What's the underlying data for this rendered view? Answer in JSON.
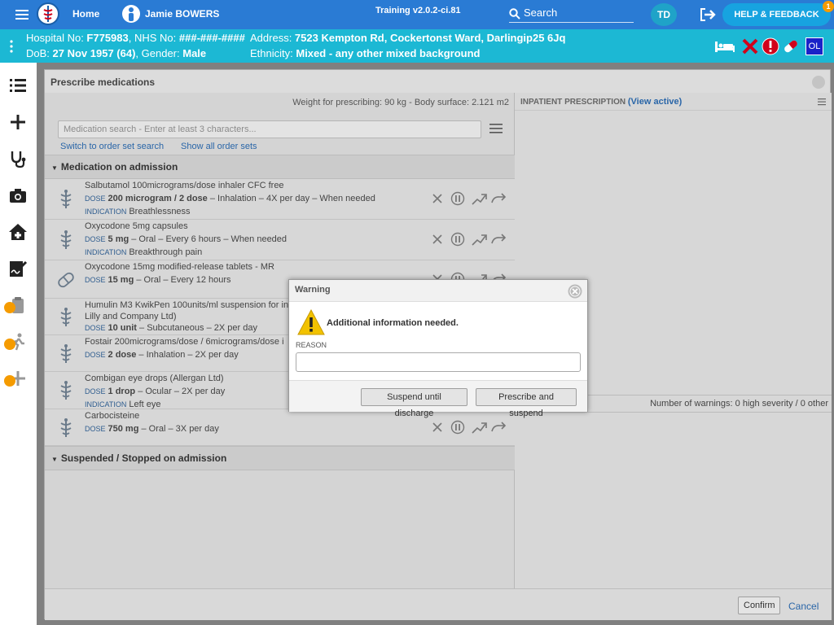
{
  "topbar": {
    "home": "Home",
    "patient_name": "Jamie BOWERS",
    "training": "Training v2.0.2-ci.81",
    "search": "Search",
    "user_initials": "TD",
    "help": "HELP & FEEDBACK",
    "help_badge": "1"
  },
  "banner": {
    "hospital_label": "Hospital No: ",
    "hospital_no": "F775983",
    "nhs_label": ", NHS No: ",
    "nhs_no": "###-###-####",
    "dob_label": "DoB: ",
    "dob": "27 Nov 1957 (64)",
    "gender_label": ", Gender: ",
    "gender": "Male",
    "address_label": "Address: ",
    "address": "7523 Kempton Rd, Cockertonst Ward, Darlingip25 6Jq",
    "ethnicity_label": "Ethnicity: ",
    "ethnicity": "Mixed - any other mixed background",
    "badge_ol": "OL"
  },
  "dialog": {
    "title": "Prescribe medications",
    "weight": "Weight for prescribing: 90 kg - Body surface: 2.121 m2",
    "search_placeholder": "Medication search - Enter at least 3 characters...",
    "switch_link": "Switch to order set search",
    "show_all_link": "Show all order sets",
    "section_admission": "Medication on admission",
    "section_suspended": "Suspended / Stopped on admission",
    "inpatient_title": "INPATIENT PRESCRIPTION",
    "view_active": "(View active)",
    "warnings_count": "Number of warnings: 0 high severity / 0 other",
    "confirm": "Confirm",
    "cancel": "Cancel"
  },
  "meds": [
    {
      "name": "Salbutamol 100micrograms/dose inhaler CFC free",
      "dose_bold": "200 microgram / 2 dose",
      "dose_rest": " – Inhalation – 4X per day – When needed",
      "indication": "Breathlessness",
      "icon": "caduceus-icon"
    },
    {
      "name": "Oxycodone 5mg capsules",
      "dose_bold": "5 mg",
      "dose_rest": " – Oral – Every 6 hours – When needed",
      "indication": "Breakthrough pain",
      "icon": "caduceus-icon"
    },
    {
      "name": "Oxycodone 15mg modified-release tablets - MR",
      "dose_bold": "15 mg",
      "dose_rest": " – Oral – Every 12 hours",
      "indication": "",
      "icon": "pill-icon"
    },
    {
      "name": "Humulin M3 KwikPen 100units/ml suspension for in",
      "name2": "Lilly and Company Ltd)",
      "dose_bold": "10 unit",
      "dose_rest": " – Subcutaneous – 2X per day",
      "indication": "",
      "icon": "caduceus-icon"
    },
    {
      "name": "Fostair 200micrograms/dose / 6micrograms/dose i",
      "dose_bold": "2 dose",
      "dose_rest": " – Inhalation – 2X per day",
      "indication": "",
      "icon": "caduceus-icon"
    },
    {
      "name": "Combigan eye drops (Allergan Ltd)",
      "dose_bold": "1 drop",
      "dose_rest": " – Ocular – 2X per day",
      "indication": "Left eye",
      "icon": "caduceus-icon"
    },
    {
      "name": "Carbocisteine",
      "dose_bold": "750 mg",
      "dose_rest": " – Oral – 3X per day",
      "indication": "",
      "icon": "caduceus-icon"
    }
  ],
  "labels": {
    "dose": "DOSE",
    "indication": "INDICATION"
  },
  "warning": {
    "title": "Warning",
    "message": "Additional information needed.",
    "reason_label": "REASON",
    "suspend_btn": "Suspend until discharge",
    "prescribe_btn": "Prescribe and suspend"
  },
  "colors": {
    "topbar": "#2a7bd4",
    "banner": "#1cb8d4",
    "help": "#17a3e0",
    "lock": "#f59b00",
    "alert": "#d0021b"
  }
}
